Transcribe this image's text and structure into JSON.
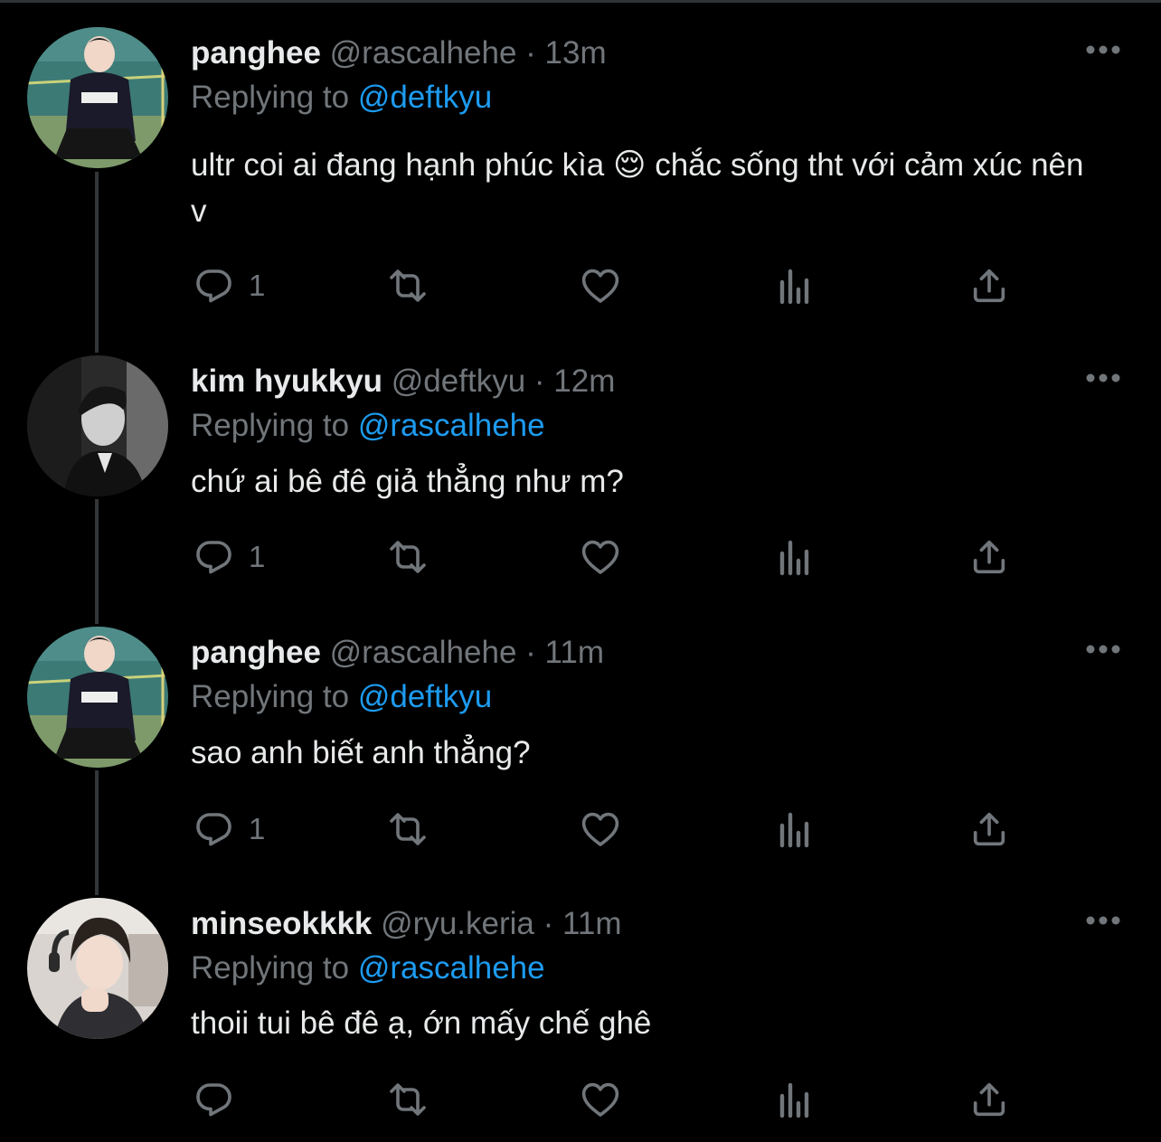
{
  "colors": {
    "background": "#000000",
    "primary_text": "#e7e9ea",
    "secondary_text": "#71767b",
    "link": "#1d9bf0",
    "thread_line": "#333639"
  },
  "tweets": [
    {
      "name": "panghee",
      "handle": "@rascalhehe",
      "separator": "·",
      "time": "13m",
      "replying_label": "Replying to",
      "replying_to": "@deftkyu",
      "text": "ultr coi ai đang hạnh phúc kìa 😌  chắc sống tht với cảm xúc nên v",
      "reply_count": "1",
      "avatar": "avatar-court-photo"
    },
    {
      "name": "kim hyukkyu",
      "handle": "@deftkyu",
      "separator": "·",
      "time": "12m",
      "replying_label": "Replying to",
      "replying_to": "@rascalhehe",
      "text": "chứ ai bê đê giả thẳng như m?",
      "reply_count": "1",
      "avatar": "avatar-monochrome-portrait"
    },
    {
      "name": "panghee",
      "handle": "@rascalhehe",
      "separator": "·",
      "time": "11m",
      "replying_label": "Replying to",
      "replying_to": "@deftkyu",
      "text": "sao anh biết anh thẳng?",
      "reply_count": "1",
      "avatar": "avatar-court-photo"
    },
    {
      "name": "minseokkkk",
      "handle": "@ryu.keria",
      "separator": "·",
      "time": "11m",
      "replying_label": "Replying to",
      "replying_to": "@rascalhehe",
      "text": "thoii tui bê đê ạ, ớn mấy chế ghê",
      "reply_count": "",
      "avatar": "avatar-webcam-photo"
    }
  ],
  "icons": {
    "more": "more-horizontal-icon",
    "reply": "reply-bubble-icon",
    "retweet": "retweet-icon",
    "like": "heart-icon",
    "views": "views-bar-chart-icon",
    "share": "share-upload-icon"
  }
}
